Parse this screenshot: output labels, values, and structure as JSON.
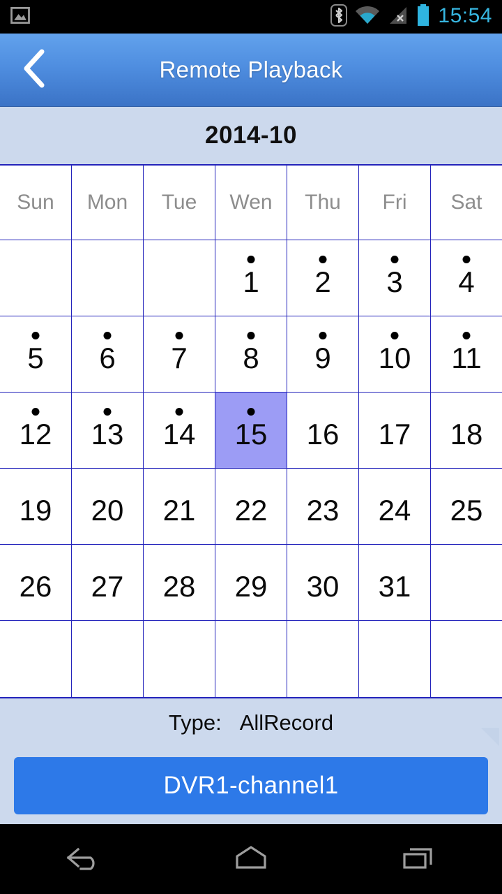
{
  "status_bar": {
    "notification_icon": "image-icon",
    "bluetooth_icon": "bluetooth-icon",
    "wifi_icon": "wifi-icon",
    "cellular_icon": "cellular-no-signal-icon",
    "battery_icon": "battery-icon",
    "clock": "15:54",
    "clock_color": "#37b6e0"
  },
  "title_bar": {
    "back_icon": "chevron-left-icon",
    "title": "Remote Playback",
    "gradient_top": "#62a2ec",
    "gradient_bottom": "#3b73c6"
  },
  "calendar": {
    "month_label": "2014-10",
    "grid_line_color": "#2323bb",
    "selected_color": "#9c9cf5",
    "weekday_headers": [
      "Sun",
      "Mon",
      "Tue",
      "Wen",
      "Thu",
      "Fri",
      "Sat"
    ],
    "selected_day": 15,
    "days_with_records": [
      1,
      2,
      3,
      4,
      5,
      6,
      7,
      8,
      9,
      10,
      11,
      12,
      13,
      14,
      15
    ],
    "weeks": [
      [
        null,
        null,
        null,
        1,
        2,
        3,
        4
      ],
      [
        5,
        6,
        7,
        8,
        9,
        10,
        11
      ],
      [
        12,
        13,
        14,
        15,
        16,
        17,
        18
      ],
      [
        19,
        20,
        21,
        22,
        23,
        24,
        25
      ],
      [
        26,
        27,
        28,
        29,
        30,
        31,
        null
      ],
      [
        null,
        null,
        null,
        null,
        null,
        null,
        null
      ]
    ]
  },
  "type_row": {
    "label": "Type:",
    "value": "AllRecord",
    "resize_handle_icon": "resize-handle-icon"
  },
  "channel_button": {
    "label": "DVR1-channel1",
    "color": "#2d79e8"
  },
  "nav_bar": {
    "back_icon": "nav-back-icon",
    "home_icon": "nav-home-icon",
    "recents_icon": "nav-recents-icon"
  }
}
